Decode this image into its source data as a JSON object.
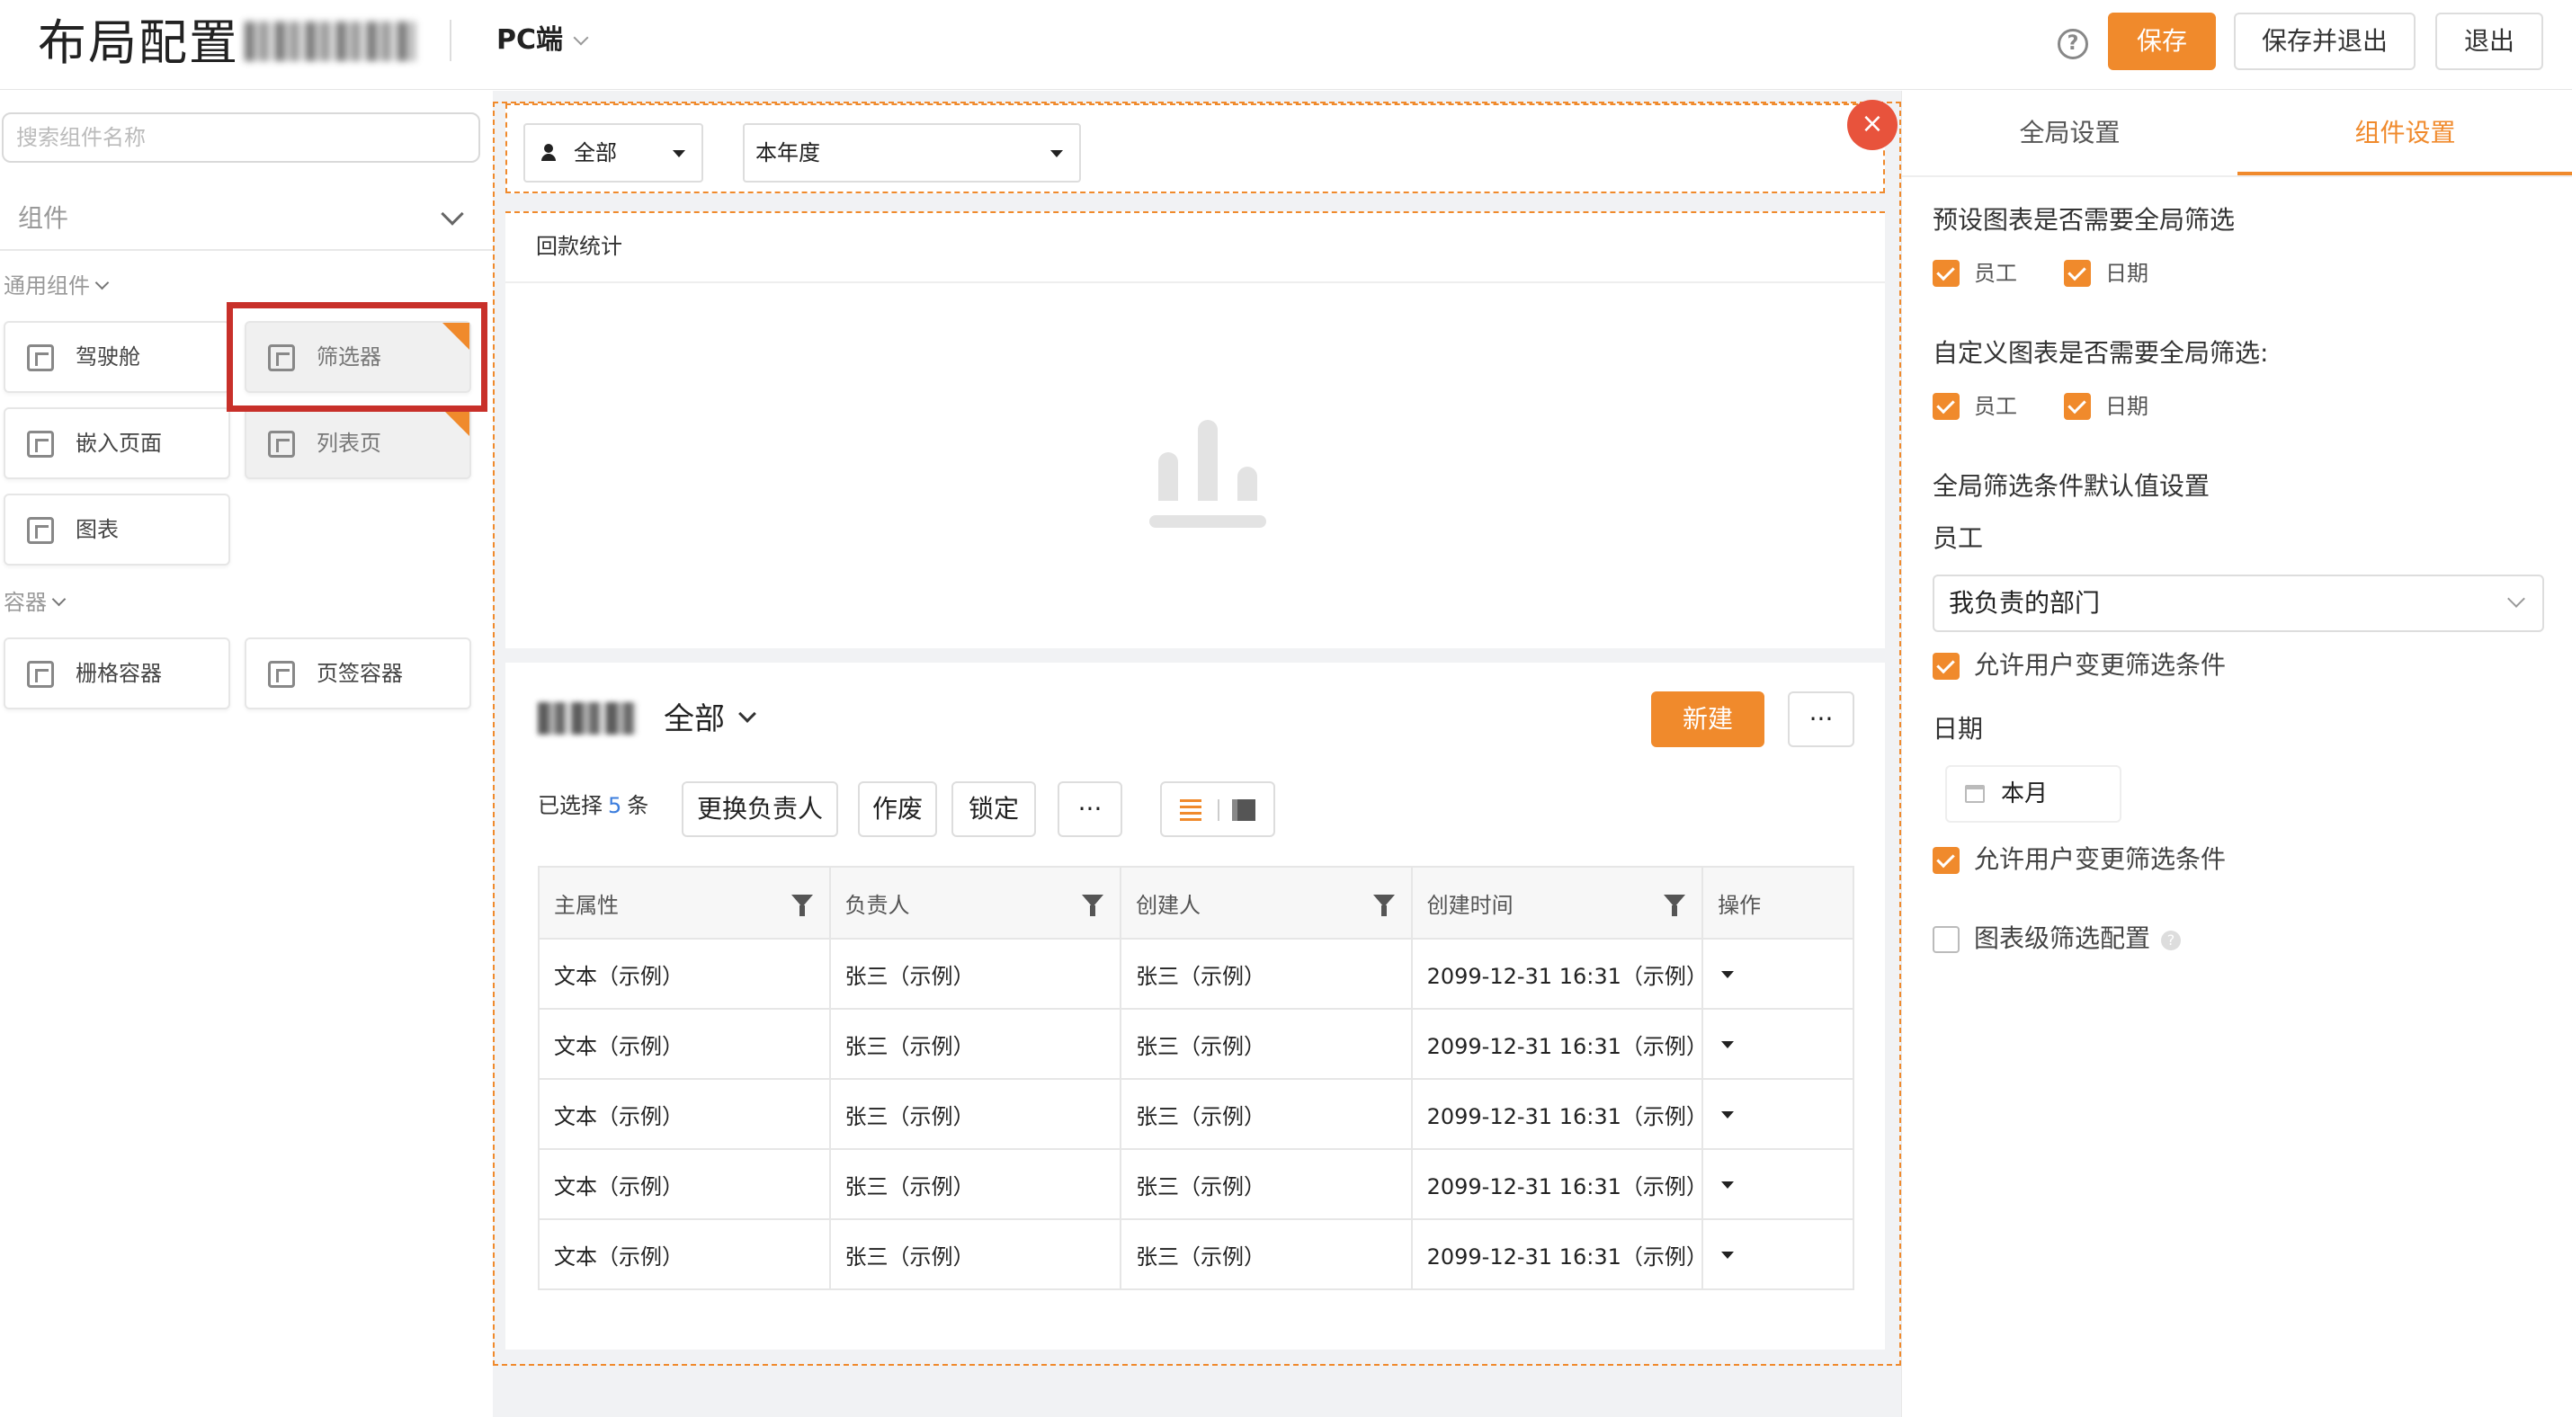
{
  "header": {
    "title": "布局配置",
    "platform": "PC端",
    "help_icon": "?",
    "save": "保存",
    "save_exit": "保存并退出",
    "exit": "退出"
  },
  "left": {
    "search_placeholder": "搜索组件名称",
    "component_select": "组件",
    "groups": [
      {
        "label": "通用组件",
        "items": [
          "驾驶舱",
          "筛选器",
          "嵌入页面",
          "列表页",
          "图表"
        ]
      },
      {
        "label": "容器",
        "items": [
          "栅格容器",
          "页签容器"
        ]
      }
    ]
  },
  "canvas": {
    "filter_employee": "全部",
    "filter_period": "本年度",
    "close_icon": "×",
    "chart_title": "回款统计",
    "list": {
      "scope": "全部",
      "new_button": "新建",
      "more": "···",
      "selected_prefix": "已选择",
      "selected_count": "5",
      "selected_suffix": "条",
      "actions": [
        "更换负责人",
        "作废",
        "锁定"
      ],
      "columns": [
        "主属性",
        "负责人",
        "创建人",
        "创建时间",
        "操作"
      ],
      "rows": [
        [
          "文本（示例）",
          "张三（示例）",
          "张三（示例）",
          "2099-12-31 16:31（示例）"
        ],
        [
          "文本（示例）",
          "张三（示例）",
          "张三（示例）",
          "2099-12-31 16:31（示例）"
        ],
        [
          "文本（示例）",
          "张三（示例）",
          "张三（示例）",
          "2099-12-31 16:31（示例）"
        ],
        [
          "文本（示例）",
          "张三（示例）",
          "张三（示例）",
          "2099-12-31 16:31（示例）"
        ],
        [
          "文本（示例）",
          "张三（示例）",
          "张三（示例）",
          "2099-12-31 16:31（示例）"
        ]
      ]
    }
  },
  "right": {
    "tab_global": "全局设置",
    "tab_component": "组件设置",
    "preset_label": "预设图表是否需要全局筛选",
    "custom_label": "自定义图表是否需要全局筛选:",
    "opt_employee": "员工",
    "opt_date": "日期",
    "defaults_label": "全局筛选条件默认值设置",
    "employee_label": "员工",
    "employee_value": "我负责的部门",
    "allow_change": "允许用户变更筛选条件",
    "date_label": "日期",
    "date_value": "本月",
    "chart_level": "图表级筛选配置",
    "info_icon": "?"
  },
  "colors": {
    "accent": "#f08a2c",
    "highlight": "#c8302a",
    "close": "#e8533c",
    "link": "#3b7ddd"
  }
}
